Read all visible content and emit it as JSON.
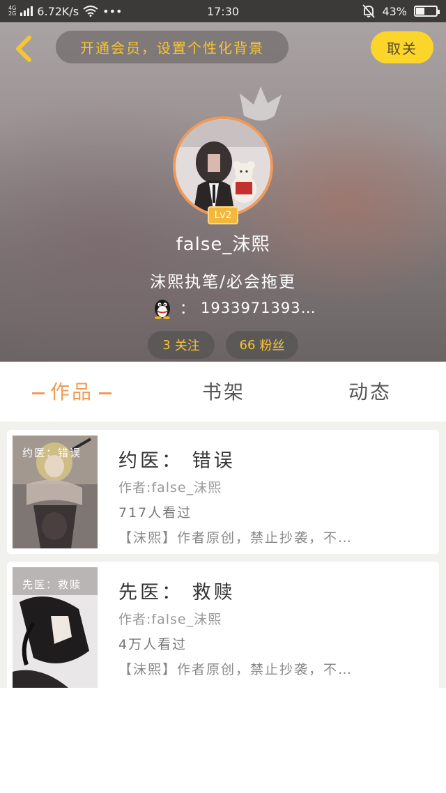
{
  "status_bar": {
    "network_top": "4G",
    "network_bottom": "2G",
    "speed": "6.72K/s",
    "more": "•••",
    "time": "17:30",
    "battery": "43%",
    "battery_level": 0.43
  },
  "header": {
    "vip_banner": "开通会员，设置个性化背景",
    "follow_label": "取关",
    "level_badge": "Lv2",
    "user_name": "false_沫熙",
    "bio": "沫熙执笔/必会拖更",
    "qq_separator": "：",
    "qq_number": "1933971393…",
    "following_count": "3",
    "following_label": "关注",
    "fans_count": "66",
    "fans_label": "粉丝"
  },
  "tabs": [
    {
      "label": "作品",
      "active": true
    },
    {
      "label": "书架",
      "active": false
    },
    {
      "label": "动态",
      "active": false
    }
  ],
  "works": [
    {
      "title": "约医： 错误",
      "cover_text": "约医：错误",
      "author": "作者:false_沫熙",
      "views": "717人看过",
      "desc": "【沫熙】作者原创，禁止抄袭，不…"
    },
    {
      "title": "先医： 救赎",
      "cover_text": "先医：救赎",
      "author": "作者:false_沫熙",
      "views": "4万人看过",
      "desc": "【沫熙】作者原创，禁止抄袭，不…"
    }
  ],
  "colors": {
    "accent_orange": "#f09a58",
    "accent_yellow": "#fcd52b",
    "banner_text": "#f7c532"
  },
  "icons": {
    "back": "chevron-left-icon",
    "crown": "crown-icon",
    "qq": "qq-penguin-icon",
    "wifi": "wifi-icon",
    "mute": "bell-off-icon"
  }
}
